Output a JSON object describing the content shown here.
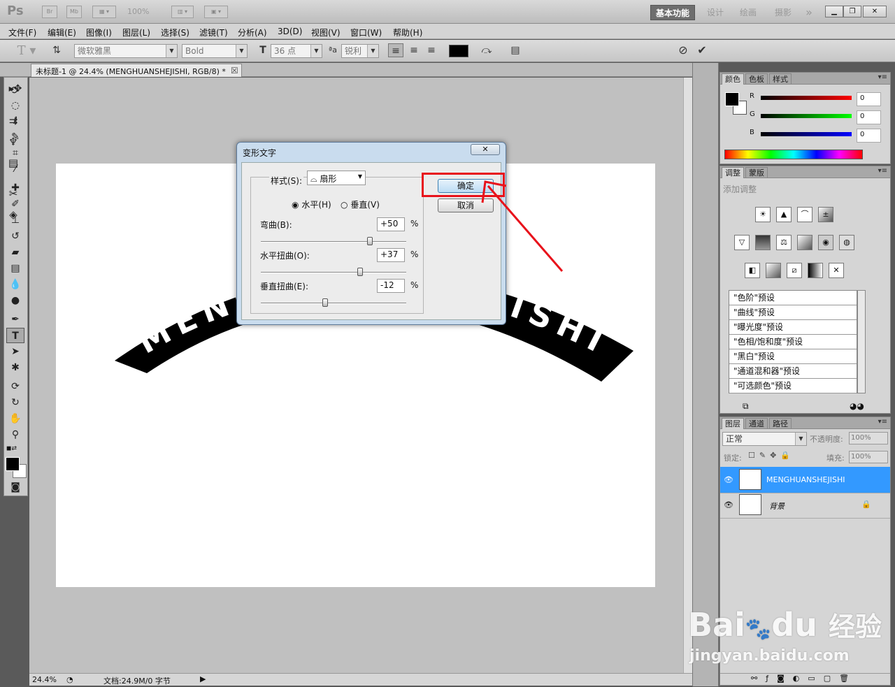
{
  "app": {
    "logo": "Ps",
    "bridge_label": "Br",
    "mini_bridge_label": "Mb",
    "zoom_level": "100%",
    "workspaces": [
      "基本功能",
      "设计",
      "绘画",
      "摄影"
    ],
    "more_workspaces": "»"
  },
  "menu": [
    "文件(F)",
    "编辑(E)",
    "图像(I)",
    "图层(L)",
    "选择(S)",
    "滤镜(T)",
    "分析(A)",
    "3D(D)",
    "视图(V)",
    "窗口(W)",
    "帮助(H)"
  ],
  "options": {
    "font_family": "微软雅黑",
    "font_style": "Bold",
    "font_size": "36 点",
    "antialias": "锐利",
    "text_color": "#000000"
  },
  "document": {
    "tab_title": "未标题-1 @ 24.4% (MENGHUANSHEJISHI, RGB/8) *",
    "close_glyph": "☒",
    "warped_text_left": "MENG",
    "warped_text_right": "ISHI"
  },
  "status": {
    "zoom": "24.4%",
    "doc_info": "文档:24.9M/0 字节"
  },
  "dialog": {
    "title": "变形文字",
    "close_glyph": "✕",
    "style_label": "样式(S):",
    "style_value": "扇形",
    "horizontal_label": "水平(H)",
    "vertical_label": "垂直(V)",
    "bend_label": "弯曲(B):",
    "bend_value": "+50",
    "hdist_label": "水平扭曲(O):",
    "hdist_value": "+37",
    "vdist_label": "垂直扭曲(E):",
    "vdist_value": "-12",
    "percent": "%",
    "bend_pct": 0.75,
    "hdist_pct": 0.685,
    "vdist_pct": 0.44,
    "ok_label": "确定",
    "cancel_label": "取消"
  },
  "color_panel": {
    "tabs": [
      "颜色",
      "色板",
      "样式"
    ],
    "r_label": "R",
    "g_label": "G",
    "b_label": "B",
    "r_value": "0",
    "g_value": "0",
    "b_value": "0",
    "foreground": "#000000",
    "background": "#ffffff"
  },
  "adjust_panel": {
    "tabs": [
      "调整",
      "蒙版"
    ],
    "heading": "添加调整",
    "presets": [
      "\"色阶\"预设",
      "\"曲线\"预设",
      "\"曝光度\"预设",
      "\"色相/饱和度\"预设",
      "\"黑白\"预设",
      "\"通道混和器\"预设",
      "\"可选颜色\"预设"
    ]
  },
  "layers_panel": {
    "tabs": [
      "图层",
      "通道",
      "路径"
    ],
    "blend_mode": "正常",
    "opacity_label": "不透明度:",
    "opacity_value": "100%",
    "lock_label": "锁定:",
    "fill_label": "填充:",
    "fill_value": "100%",
    "layers": [
      {
        "name": "MENGHUANSHEJISHI",
        "thumb": "T"
      },
      {
        "name": "背景",
        "thumb": ""
      }
    ],
    "selected_color": "#3399ff"
  },
  "watermark": {
    "brand_a": "Bai",
    "brand_b": "du",
    "brand_c": "经验",
    "url": "jingyan.baidu.com"
  }
}
